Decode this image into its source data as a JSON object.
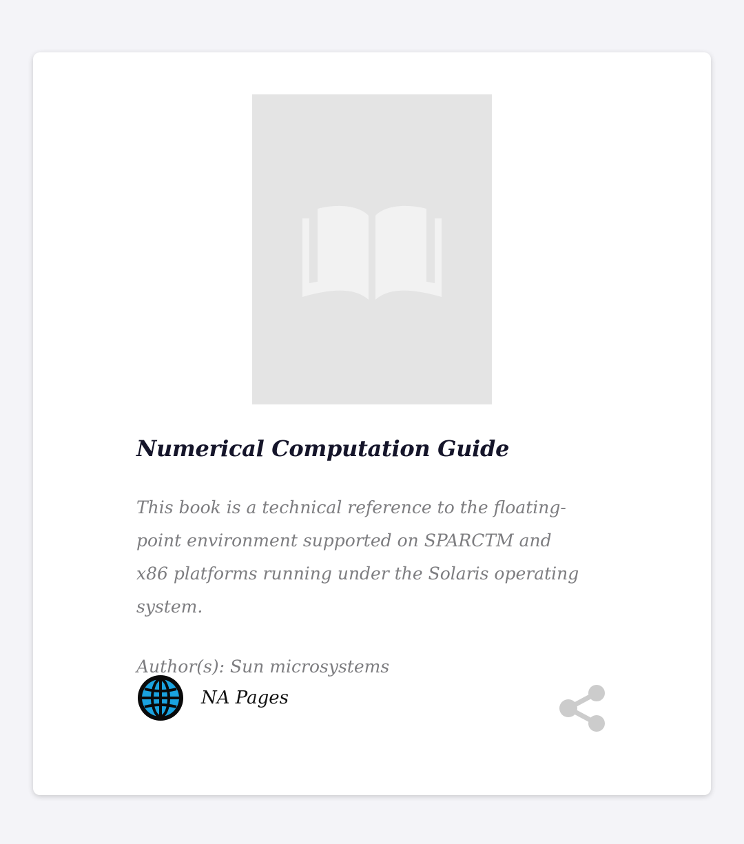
{
  "book": {
    "cover_icon": "open-book-icon",
    "title": "Numerical Computation Guide",
    "description": "This book is a technical reference to the floating-point environment supported on SPARCTM and x86 platforms running under the Solaris operating system.",
    "author": "Author(s): Sun microsystems",
    "publisher_icon": "globe-icon",
    "pages": "NA Pages",
    "share_icon": "share-icon"
  },
  "colors": {
    "page_background": "#f4f4f8",
    "card_background": "#ffffff",
    "cover_placeholder": "#e4e4e4",
    "title": "#15152a",
    "muted_text": "#7d7d80",
    "globe_blue": "#1aa3e0",
    "share_icon": "#cccccc"
  }
}
